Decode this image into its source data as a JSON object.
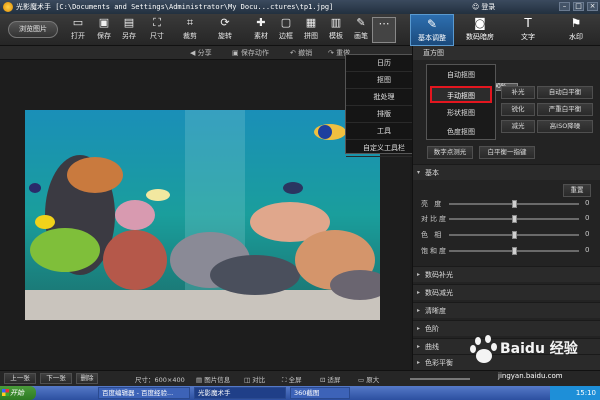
{
  "titlebar": {
    "title": "光影魔术手 [C:\\Documents and Settings\\Administrator\\My Docu...ctures\\tp1.jpg]",
    "login": "登录"
  },
  "toolbar": {
    "browse": "浏览图片",
    "tools": [
      {
        "label": "打开",
        "icon": "▭"
      },
      {
        "label": "保存",
        "icon": "▣"
      },
      {
        "label": "另存",
        "icon": "▤"
      },
      {
        "label": "尺寸",
        "icon": "⛶"
      },
      {
        "label": "裁剪",
        "icon": "⌗"
      },
      {
        "label": "旋转",
        "icon": "⟳"
      },
      {
        "label": "素材",
        "icon": "✚"
      },
      {
        "label": "边框",
        "icon": "▢"
      },
      {
        "label": "拼图",
        "icon": "▦"
      },
      {
        "label": "模板",
        "icon": "▥"
      },
      {
        "label": "画笔",
        "icon": "✎"
      },
      {
        "label": "",
        "icon": "⋯"
      }
    ],
    "right_tabs": [
      {
        "label": "基本调整",
        "icon": "✎"
      },
      {
        "label": "数码暗房",
        "icon": "◙"
      },
      {
        "label": "文字",
        "icon": "T"
      },
      {
        "label": "水印",
        "icon": "⚑"
      }
    ]
  },
  "subbar": {
    "share": "分享",
    "save_action": "保存动作",
    "undo": "撤销",
    "redo": "重做"
  },
  "dropdown": [
    "日历",
    "抠图",
    "批处理",
    "排版",
    "工具",
    "自定义工具栏"
  ],
  "submenu": {
    "items": [
      "自动抠图",
      "手动抠图",
      "形状抠图",
      "色度抠图"
    ],
    "active_index": 1
  },
  "panel": {
    "header": "直方图",
    "zoom": "100%",
    "buttons": [
      "补光",
      "自动白平衡",
      "锐化",
      "严重白平衡",
      "减光",
      "高ISO降噪",
      "数字点测光",
      "白平衡一指键"
    ],
    "basic_section": "基本",
    "reset": "重置",
    "sliders": [
      {
        "label": "亮 度",
        "value": "0",
        "level": 0.5
      },
      {
        "label": "对比度",
        "value": "0",
        "level": 0.5
      },
      {
        "label": "色 相",
        "value": "0",
        "level": 0.5
      },
      {
        "label": "饱和度",
        "value": "0",
        "level": 0.5
      }
    ],
    "sections": [
      "数码补光",
      "数码减光",
      "清晰度",
      "色阶",
      "曲线",
      "色彩平衡"
    ]
  },
  "statusbar": {
    "prev": "上一张",
    "next": "下一张",
    "delete": "删除",
    "size": "尺寸：600×400",
    "info": "图片信息",
    "compare": "对比",
    "fullscreen": "全屏",
    "fit": "适屏",
    "original": "原大"
  },
  "taskbar": {
    "start": "开始",
    "tasks": [
      "百度编辑器 - 百度经验...",
      "光影魔术手",
      "360截图"
    ],
    "clock": "15:10"
  },
  "watermark": {
    "brand": "Baidu 经验",
    "url": "jingyan.baidu.com"
  }
}
